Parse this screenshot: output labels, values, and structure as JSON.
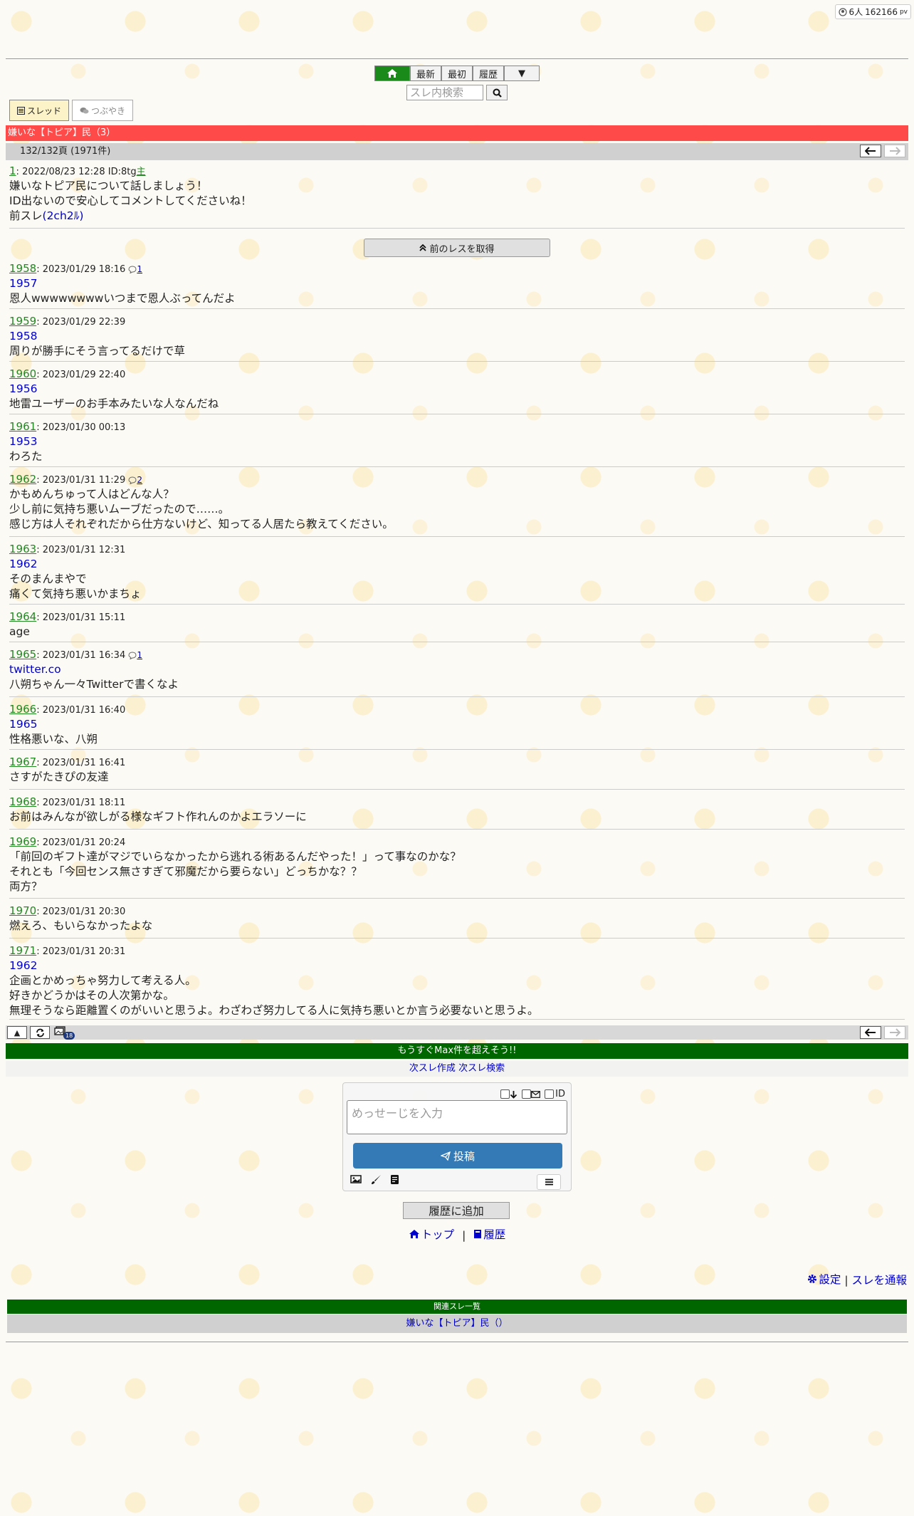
{
  "counter": {
    "users": "6人",
    "views": "162166",
    "views_unit": "pv"
  },
  "nav": {
    "latest": "最新",
    "first": "最初",
    "history": "履歴",
    "more": "▼"
  },
  "search": {
    "placeholder": "スレ内検索"
  },
  "tabs": {
    "thread": "スレッド",
    "tweet": "つぶやき"
  },
  "thread": {
    "title": "嫌いな【トピア】民（3）",
    "page_info": "132/132頁 (1971件)"
  },
  "op": {
    "num": "1",
    "date": "2022/08/23 12:28",
    "id": "ID:8tg",
    "owner_mark": "主",
    "lines": [
      "嫌いなトピア民について話しましょう！",
      "ID出ないので安心してコメントしてくださいね！"
    ],
    "prev_prefix": "前スレ",
    "prev_link": "(2ch2ﾙ)"
  },
  "prev_button": "前のレスを取得",
  "posts": [
    {
      "num": "1958",
      "date": "2023/01/29 18:16",
      "replies": "1",
      "anchor": "1957",
      "lines": [
        "恩人wwwwwwwwいつまで恩人ぶってんだよ"
      ]
    },
    {
      "num": "1959",
      "date": "2023/01/29 22:39",
      "replies": "",
      "anchor": "1958",
      "lines": [
        "周りが勝手にそう言ってるだけで草"
      ]
    },
    {
      "num": "1960",
      "date": "2023/01/29 22:40",
      "replies": "",
      "anchor": "1956",
      "lines": [
        "地雷ユーザーのお手本みたいな人なんだね"
      ]
    },
    {
      "num": "1961",
      "date": "2023/01/30 00:13",
      "replies": "",
      "anchor": "1953",
      "lines": [
        "わろた"
      ]
    },
    {
      "num": "1962",
      "date": "2023/01/31 11:29",
      "replies": "2",
      "anchor": "",
      "lines": [
        "かもめんちゅって人はどんな人？",
        "少し前に気持ち悪いムーブだったので……。",
        "感じ方は人それぞれだから仕方ないけど、知ってる人居たら教えてください。"
      ]
    },
    {
      "num": "1963",
      "date": "2023/01/31 12:31",
      "replies": "",
      "anchor": "1962",
      "lines": [
        "そのまんまやで",
        "痛くて気持ち悪いかまちょ"
      ]
    },
    {
      "num": "1964",
      "date": "2023/01/31 15:11",
      "replies": "",
      "anchor": "",
      "lines": [
        "age"
      ]
    },
    {
      "num": "1965",
      "date": "2023/01/31 16:34",
      "replies": "1",
      "anchor": "twitter.co",
      "lines": [
        "八朔ちゃん一々Twitterで書くなよ"
      ]
    },
    {
      "num": "1966",
      "date": "2023/01/31 16:40",
      "replies": "",
      "anchor": "1965",
      "lines": [
        "性格悪いな、八朔"
      ]
    },
    {
      "num": "1967",
      "date": "2023/01/31 16:41",
      "replies": "",
      "anchor": "",
      "lines": [
        "さすがたきぴの友達"
      ]
    },
    {
      "num": "1968",
      "date": "2023/01/31 18:11",
      "replies": "",
      "anchor": "",
      "lines": [
        "お前はみんなが欲しがる様なギフト作れんのかよエラソーに"
      ]
    },
    {
      "num": "1969",
      "date": "2023/01/31 20:24",
      "replies": "",
      "anchor": "",
      "lines": [
        "「前回のギフト達がマジでいらなかったから逃れる術あるんだやった！」って事なのかな？",
        "それとも「今回センス無さすぎて邪魔だから要らない」どっちかな？？",
        "両方？"
      ]
    },
    {
      "num": "1970",
      "date": "2023/01/31 20:30",
      "replies": "",
      "anchor": "",
      "lines": [
        "燃えろ、もいらなかったよな"
      ]
    },
    {
      "num": "1971",
      "date": "2023/01/31 20:31",
      "replies": "",
      "anchor": "1962",
      "lines": [
        "企画とかめっちゃ努力して考える人。",
        "好きかどうかはその人次第かな。",
        "無理そうなら距離置くのがいいと思うよ。わざわざ努力してる人に気持ち悪いとか言う必要ないと思うよ。"
      ]
    }
  ],
  "bottom": {
    "up": "▲",
    "badge": "18"
  },
  "warning": "もうすぐMax件を超えそう!!",
  "next_links": {
    "create": "次スレ作成",
    "search": "次スレ検索"
  },
  "form": {
    "id_label": "ID",
    "placeholder": "めっせーじを入力",
    "submit": "投稿"
  },
  "history_add": "履歴に追加",
  "links": {
    "top": "トップ",
    "sep": "|",
    "history": "履歴"
  },
  "footer": {
    "settings": "設定",
    "sep": "|",
    "report": "スレを通報"
  },
  "related": {
    "heading": "関連スレ一覧",
    "items": [
      "嫌いな【トピア】民（）"
    ]
  }
}
